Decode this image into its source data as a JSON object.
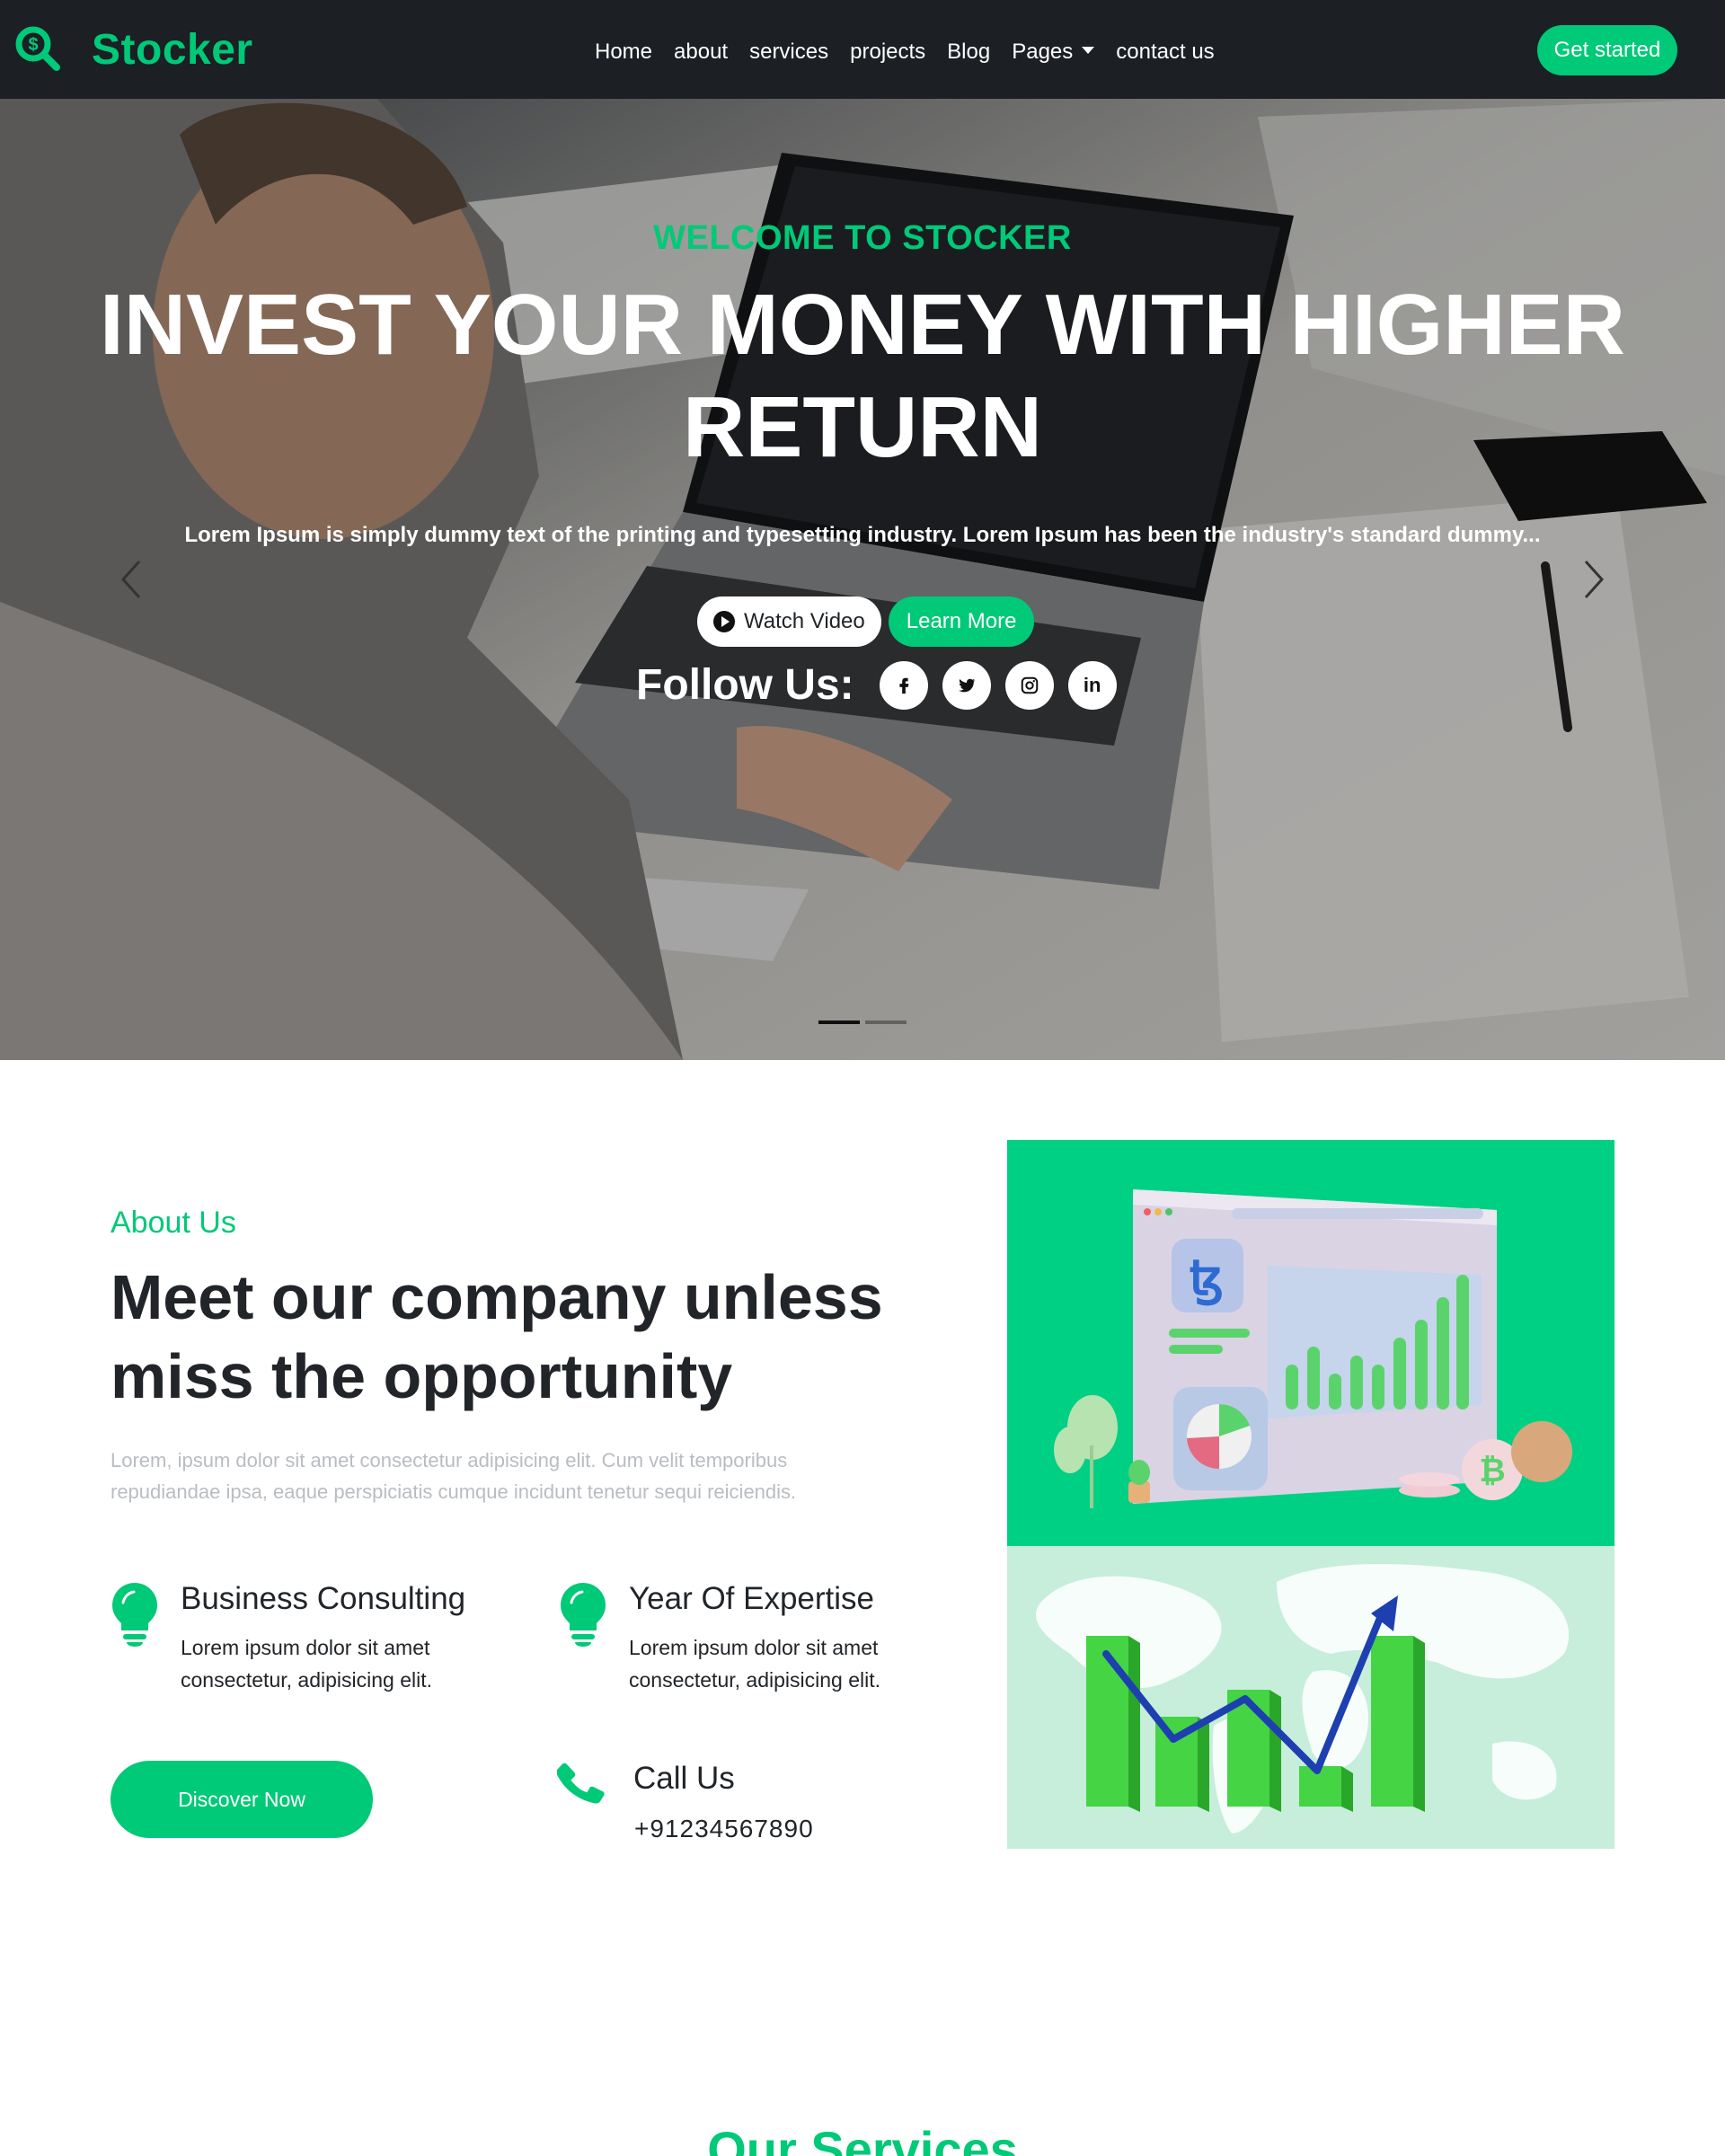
{
  "nav": {
    "brand": "Stocker",
    "links": [
      "Home",
      "about",
      "services",
      "projects",
      "Blog",
      "Pages",
      "contact us"
    ],
    "cta": "Get started"
  },
  "hero": {
    "eyebrow": "WELCOME TO STOCKER",
    "title": "INVEST YOUR MONEY WITH HIGHER RETURN",
    "description": "Lorem Ipsum is simply dummy text of the printing and typesetting industry. Lorem Ipsum has been the industry's standard dummy...",
    "watch_video": "Watch Video",
    "learn_more": "Learn More",
    "follow_label": "Follow Us:",
    "socials": [
      "facebook-icon",
      "twitter-icon",
      "instagram-icon",
      "linkedin-icon"
    ],
    "linkedin_text": "in",
    "slides": 2,
    "active_slide": 1
  },
  "about": {
    "eyebrow": "About Us",
    "title": "Meet our company unless miss the opportunity",
    "description": "Lorem, ipsum dolor sit amet consectetur adipisicing elit. Cum velit temporibus repudiandae ipsa, eaque perspiciatis cumque incidunt tenetur sequi reiciendis.",
    "features": [
      {
        "title": "Business Consulting",
        "text": "Lorem ipsum dolor sit amet consectetur, adipisicing elit."
      },
      {
        "title": "Year Of Expertise",
        "text": "Lorem ipsum dolor sit amet consectetur, adipisicing elit."
      }
    ],
    "discover": "Discover Now",
    "call_title": "Call Us",
    "call_number": "+91234567890"
  },
  "services": {
    "title": "Our Services"
  },
  "colors": {
    "accent": "#00c978",
    "navbar": "#1c1f24"
  }
}
